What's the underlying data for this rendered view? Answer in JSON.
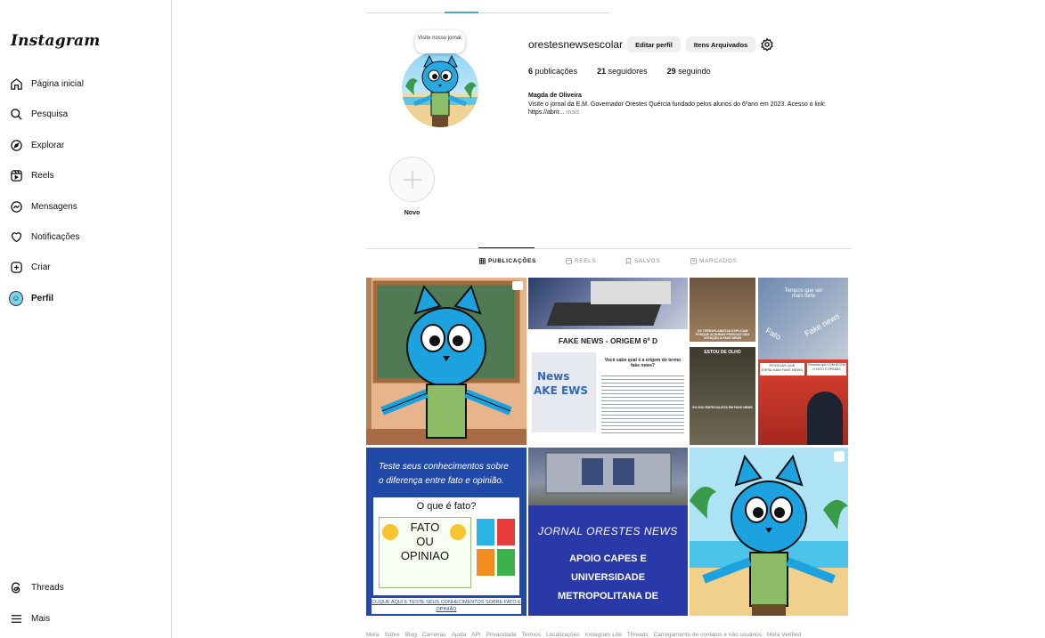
{
  "sidebar": {
    "logo": "Instagram",
    "items": [
      {
        "label": "Página inicial"
      },
      {
        "label": "Pesquisa"
      },
      {
        "label": "Explorar"
      },
      {
        "label": "Reels"
      },
      {
        "label": "Mensagens"
      },
      {
        "label": "Notificações"
      },
      {
        "label": "Criar"
      },
      {
        "label": "Perfil"
      }
    ],
    "bottom": [
      {
        "label": "Threads"
      },
      {
        "label": "Mais"
      }
    ]
  },
  "profile": {
    "note": "Visite nosso jornal.",
    "username": "orestesnewsescolar",
    "edit_button": "Editar perfil",
    "archive_button": "Itens Arquivados",
    "stats": {
      "posts_count": "6",
      "posts_label": "publicações",
      "followers_count": "21",
      "followers_label": "seguidores",
      "following_count": "29",
      "following_label": "seguindo"
    },
    "full_name": "Magda de Oliveira",
    "bio": "Visite o jornal da E.M. Governador Orestes Quércia fundado pelos alunos do 6ºano em 2023. Acesso o link: https://abrir...",
    "bio_more": "mais"
  },
  "highlights": [
    {
      "label": "Novo"
    }
  ],
  "tabs": [
    "PUBLICAÇÕES",
    "REELS",
    "SALVOS",
    "MARCADOS"
  ],
  "posts": {
    "p2_title": "FAKE NEWS - ORIGEM 6º D",
    "p2_question": "Você sabe qual é a origem do termo fake news?",
    "p3_caption1": "OS TERRAPLANISTAS EXPLICAM PORQUE ALGUMAS PESSOAS DÃO ATENÇÃO A FAKE NEWS",
    "p3_caption2": "ESTOU DE OLHO",
    "p3_caption3": "EU SOU ESPECIALISTA EM FAKE NEWS",
    "p4_text1": "Tempos que ser mais forte",
    "p4_text2": "Fato",
    "p4_text3": "Fake news",
    "p4_text4": "PESSOAS QUE ESPALHAM FAKE NEWS",
    "p4_text5": "Pessoas que CONHECEM O FATO E OPINIÃO",
    "p5_title": "Teste seus conhecimentos sobre o diferença entre fato e opinião.",
    "p5_question": "O que é fato?",
    "p5_fato": "FATO",
    "p5_ou": "OU",
    "p5_opiniao": "OPINIAO",
    "p5_link": "CLIQUE AQUI E TESTE SEUS CONHECIMENTOS SOBRE FATO E OPINIÃO",
    "p6_title": "JORNAL ORESTES NEWS",
    "p6_sub1": "APOIO CAPES E",
    "p6_sub2": "UNIVERSIDADE",
    "p6_sub3": "METROPOLITANA DE"
  },
  "footer": [
    "Meta",
    "Sobre",
    "Blog",
    "Carreiras",
    "Ajuda",
    "API",
    "Privacidade",
    "Termos",
    "Localizações",
    "Instagram Lite",
    "Threads",
    "Carregamento de contatos e não usuários",
    "Meta Verified"
  ],
  "colors": {
    "accent": "#0095f6",
    "mascot": "#29a8e0",
    "blue_post": "#2a3fb0"
  }
}
